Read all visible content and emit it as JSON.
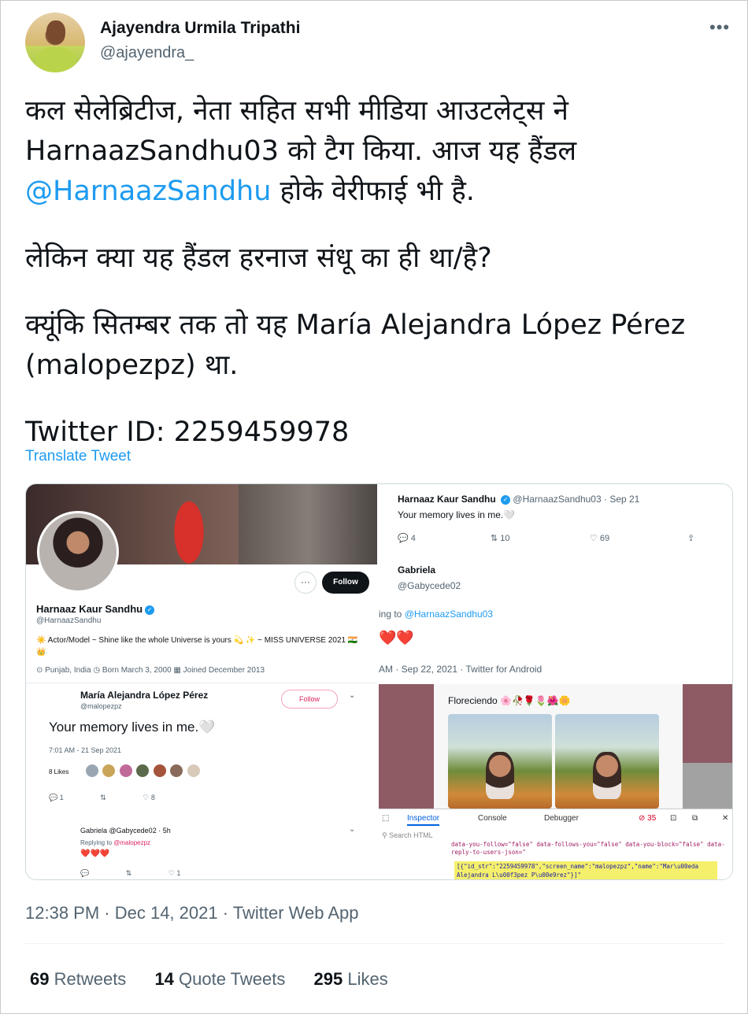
{
  "author": {
    "name": "Ajayendra Urmila Tripathi",
    "handle": "@ajayendra_"
  },
  "menu_icon": "more-horizontal-icon",
  "tweet": {
    "line1": "कल सेलेब्रिटीज, नेता सहित सभी मीडिया आउटलेट्स ने HarnaazSandhu03 को टैग किया. आज यह हैंडल ",
    "mention": "@HarnaazSandhu",
    "line1_end": " होके वेरीफाई भी है.",
    "para2": "लेकिन क्या यह हैंडल हरनाज संधू का ही था/है?",
    "para3": "क्यूंकि सितम्बर तक तो यह María Alejandra López Pérez (malopezpz) था.",
    "para4": "Twitter ID: 2259459978"
  },
  "translate_label": "Translate Tweet",
  "media": {
    "left": {
      "more_label": "···",
      "follow_label": "Follow",
      "profile_name": "Harnaaz Kaur Sandhu",
      "verified_mark": "✓",
      "profile_handle": "@HarnaazSandhu",
      "bio": "☀️ Actor/Model ~ Shine like the whole Universe is yours 💫 ✨ ~ MISS UNIVERSE 2021 🇮🇳 👑",
      "meta": "⊙ Punjab, India   ◷ Born March 3, 2000   ▦ Joined December 2013",
      "sub_name": "María Alejandra López Pérez",
      "sub_handle": "@malopezpz",
      "sub_follow": "Follow",
      "sub_text": "Your memory lives in me.🤍",
      "sub_time": "7:01 AM - 21 Sep 2021",
      "sub_likes": "8 Likes",
      "sub_actions": [
        "💬 1",
        "⇅",
        "♡ 8"
      ],
      "reply_name": "Gabriela @Gabycede02 · 5h",
      "reply_to_prefix": "Replying to ",
      "reply_to_handle": "@malopezpz",
      "reply_hearts": "❤️❤️❤️",
      "reply_actions": [
        "💬",
        "⇅",
        "♡ 1"
      ]
    },
    "right": {
      "name": "Harnaaz Kaur Sandhu",
      "handle_date": "@HarnaazSandhu03 · Sep 21",
      "text": "Your memory lives in me.🤍",
      "actions": [
        "💬  4",
        "⇅  10",
        "♡  69",
        "⇪"
      ],
      "reply_name": "Gabriela",
      "reply_handle": "@Gabycede02",
      "reply_prefix": "ing to ",
      "reply_mention": "@HarnaazSandhu03",
      "hearts": "❤️❤️",
      "date": "AM · Sep 22, 2021 · Twitter for Android",
      "floreciendo": "Floreciendo 🌸🥀🌹🌷🌺🌼",
      "devtools_tabs": [
        "⬚",
        "Inspector",
        "Console",
        "Debugger",
        "⊘ 35",
        "⊡",
        "⧉",
        "✕"
      ],
      "devtools_search": "⚲ Search HTML",
      "code_line": "data-you-follow=\"false\" data-follows-you=\"false\" data-you-block=\"false\" data-reply-to-users-json=\"",
      "code_highlight": "[{\"id_str\":\"2259459978\",\"screen_name\":\"malopezpz\",\"name\":\"Mar\\u00eda Alejandra L\\u00f3pez P\\u00e9rez\"}]\""
    }
  },
  "timestamp": "12:38 PM · Dec 14, 2021 · Twitter Web App",
  "stats": {
    "retweets_count": "69",
    "retweets_label": " Retweets",
    "quotes_count": "14",
    "quotes_label": " Quote Tweets",
    "likes_count": "295",
    "likes_label": " Likes"
  }
}
